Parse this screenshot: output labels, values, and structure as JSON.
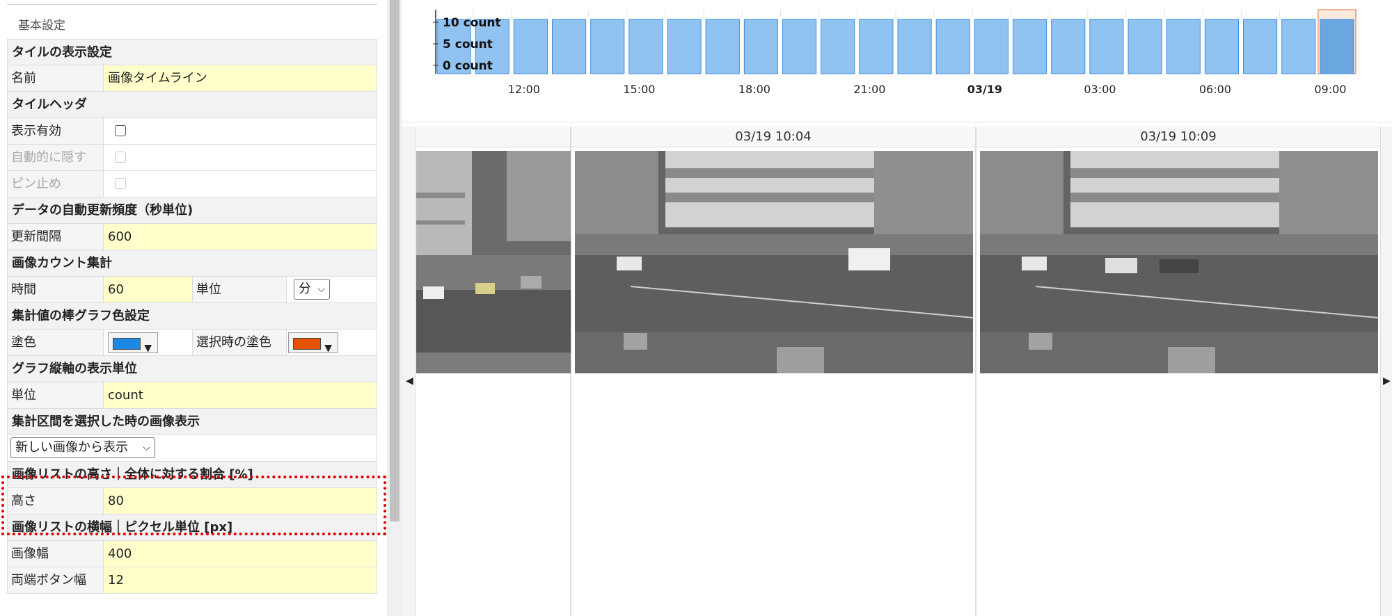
{
  "panel": {
    "header": "基本設定",
    "tile_display": {
      "section": "タイルの表示設定",
      "name_label": "名前",
      "name_value": "画像タイムライン"
    },
    "tile_header": {
      "section": "タイルヘッダ",
      "display_enabled": "表示有効",
      "auto_hide": "自動的に隠す",
      "pin": "ピン止め"
    },
    "auto_refresh": {
      "section": "データの自動更新頻度（秒単位)",
      "interval_label": "更新間隔",
      "interval_value": "600"
    },
    "image_count": {
      "section": "画像カウント集計",
      "time_label": "時間",
      "time_value": "60",
      "unit_label": "単位",
      "unit_value": "分"
    },
    "bar_color": {
      "section": "集計値の棒グラフ色設定",
      "fill_label": "塗色",
      "fill_color": "#1e88e5",
      "selected_label": "選択時の塗色",
      "selected_color": "#e65100"
    },
    "y_axis_unit": {
      "section": "グラフ縦軸の表示単位",
      "unit_label": "単位",
      "unit_value": "count"
    },
    "range_select": {
      "section": "集計区間を選択した時の画像表示",
      "select_value": "新しい画像から表示"
    },
    "list_height": {
      "section": "画像リストの高さ｜全体に対する割合 [%]",
      "height_label": "高さ",
      "height_value": "80"
    },
    "list_width": {
      "section": "画像リストの横幅｜ピクセル単位 [px]",
      "image_width_label": "画像幅",
      "image_width_value": "400",
      "edge_button_label": "両端ボタン幅",
      "edge_button_value": "12"
    }
  },
  "timeline": {
    "column_1_time": "03/19 10:04",
    "column_2_time": "03/19 10:09",
    "prev_arrow": "◀",
    "next_arrow": "▶"
  },
  "chart_data": {
    "type": "bar",
    "y_ticks": [
      "10 count",
      "5 count",
      "0 count"
    ],
    "x_ticks": [
      "12:00",
      "15:00",
      "18:00",
      "21:00",
      "03/19",
      "03:00",
      "06:00",
      "09:00"
    ],
    "bold_tick": "03/19",
    "ylim": [
      0,
      12
    ],
    "values": [
      12,
      12,
      12,
      12,
      12,
      12,
      12,
      12,
      12,
      12,
      12,
      12,
      12,
      12,
      12,
      12,
      12,
      12,
      12,
      12,
      12,
      12,
      12,
      12
    ],
    "selected_index": 23,
    "bar_color": "#90c2f2",
    "bar_stroke": "#3f8ee0",
    "selected_color": "#6aa6e0",
    "selected_stroke": "#e86a30"
  }
}
